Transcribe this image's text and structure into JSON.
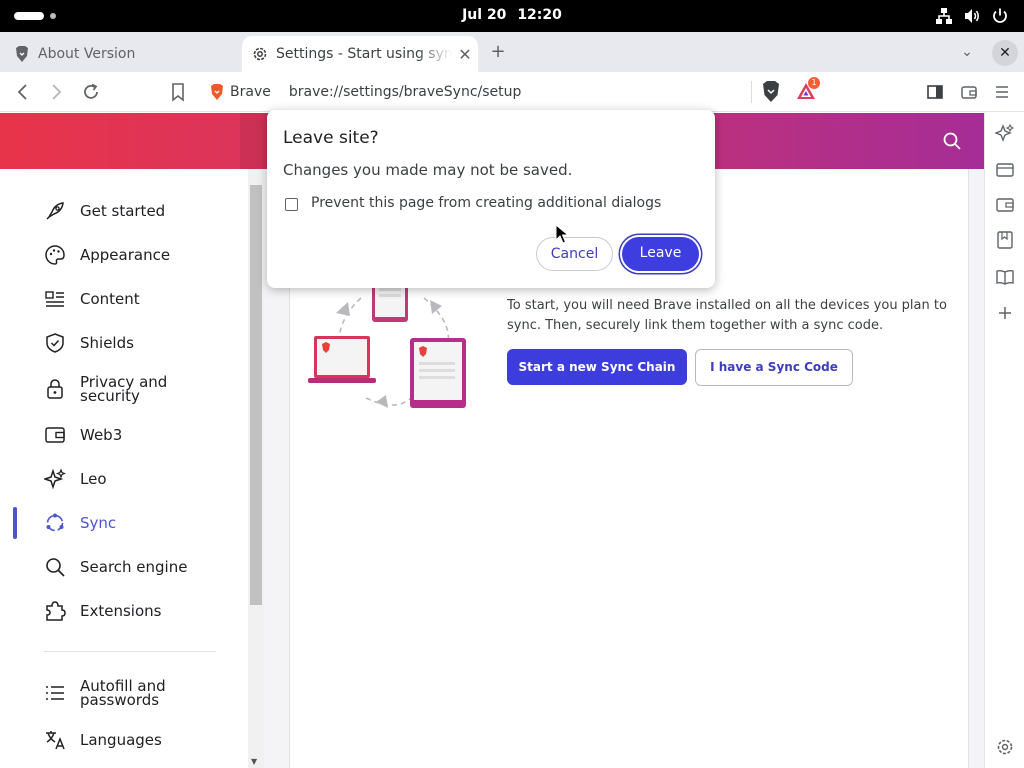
{
  "system_bar": {
    "date": "Jul 20",
    "time": "12:20"
  },
  "tabs": [
    {
      "title": "About Version",
      "active": false,
      "icon": "brave-lion-icon"
    },
    {
      "title": "Settings - Start using sync",
      "active": true,
      "icon": "gear-icon"
    }
  ],
  "toolbar": {
    "site_label": "Brave",
    "url": "brave://settings/braveSync/setup",
    "notification_count": "1"
  },
  "sidebar": {
    "items": [
      {
        "label": "Get started",
        "icon": "rocket-icon"
      },
      {
        "label": "Appearance",
        "icon": "palette-icon"
      },
      {
        "label": "Content",
        "icon": "content-list-icon"
      },
      {
        "label": "Shields",
        "icon": "shield-icon"
      },
      {
        "label": "Privacy and security",
        "icon": "lock-icon"
      },
      {
        "label": "Web3",
        "icon": "wallet-icon"
      },
      {
        "label": "Leo",
        "icon": "leo-sparkle-icon"
      },
      {
        "label": "Sync",
        "icon": "sync-icon",
        "selected": true
      },
      {
        "label": "Search engine",
        "icon": "search-icon"
      },
      {
        "label": "Extensions",
        "icon": "puzzle-icon"
      },
      {
        "label": "Autofill and passwords",
        "icon": "autofill-list-icon"
      },
      {
        "label": "Languages",
        "icon": "translate-icon"
      }
    ]
  },
  "sync": {
    "description": "To start, you will need Brave installed on all the devices you plan to sync. Then, securely link them together with a sync code.",
    "start_chain_label": "Start a new Sync Chain",
    "have_code_label": "I have a Sync Code"
  },
  "dialog": {
    "title": "Leave site?",
    "message": "Changes you made may not be saved.",
    "checkbox_label": "Prevent this page from creating additional dialogs",
    "checkbox_checked": false,
    "cancel_label": "Cancel",
    "leave_label": "Leave"
  },
  "colors": {
    "accent": "#3d3dde",
    "header_gradient_start": "#e8344a",
    "header_gradient_end": "#a52d96",
    "badge": "#f85d38"
  }
}
